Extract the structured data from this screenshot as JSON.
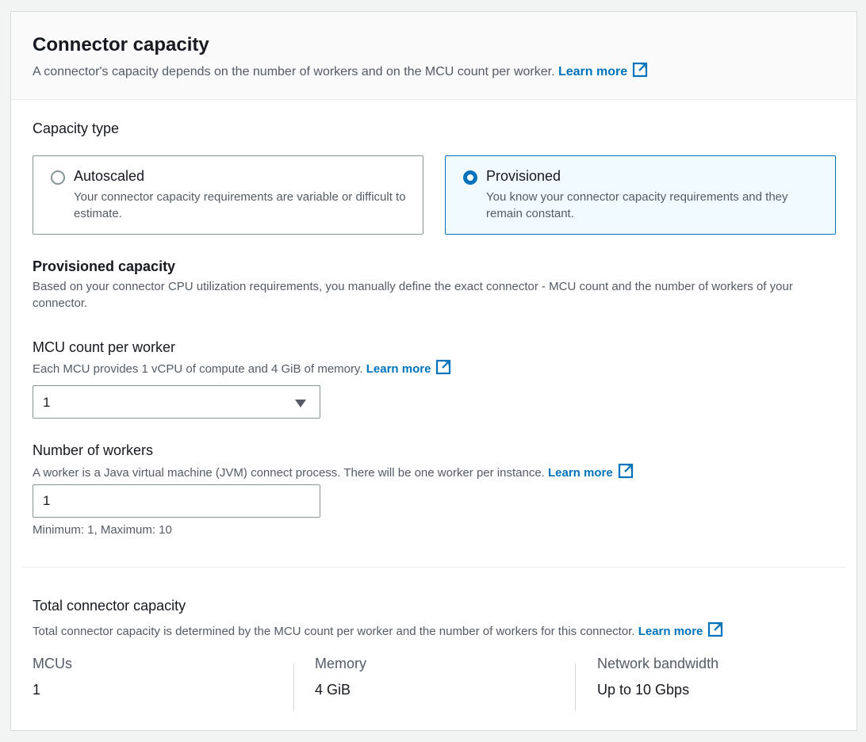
{
  "header": {
    "title": "Connector capacity",
    "description": "A connector's capacity depends on the number of workers and on the MCU count per worker.",
    "learn_more": "Learn more"
  },
  "capacity_type": {
    "label": "Capacity type",
    "options": [
      {
        "title": "Autoscaled",
        "description": "Your connector capacity requirements are variable or difficult to estimate.",
        "selected": false
      },
      {
        "title": "Provisioned",
        "description": "You know your connector capacity requirements and they remain constant.",
        "selected": true
      }
    ]
  },
  "provisioned": {
    "title": "Provisioned capacity",
    "description": "Based on your connector CPU utilization requirements, you manually define the exact connector - MCU count and the number of workers of your connector."
  },
  "mcu": {
    "label": "MCU count per worker",
    "description": "Each MCU provides 1 vCPU of compute and 4 GiB of memory.",
    "learn_more": "Learn more",
    "value": "1"
  },
  "workers": {
    "label": "Number of workers",
    "description": "A worker is a Java virtual machine (JVM) connect process. There will be one worker per instance.",
    "learn_more": "Learn more",
    "value": "1",
    "constraint": "Minimum: 1, Maximum: 10"
  },
  "total": {
    "title": "Total connector capacity",
    "description": "Total connector capacity is determined by the MCU count per worker and the number of workers for this connector.",
    "learn_more": "Learn more",
    "columns": [
      {
        "label": "MCUs",
        "value": "1"
      },
      {
        "label": "Memory",
        "value": "4 GiB"
      },
      {
        "label": "Network bandwidth",
        "value": "Up to 10 Gbps"
      }
    ]
  },
  "colors": {
    "accent": "#0073bb",
    "selected_bg": "#f1faff",
    "text": "#16191f",
    "secondary_text": "#545b64",
    "border": "#879596"
  },
  "icons": {
    "external_link": "external-link-icon",
    "dropdown": "caret-down-icon"
  }
}
